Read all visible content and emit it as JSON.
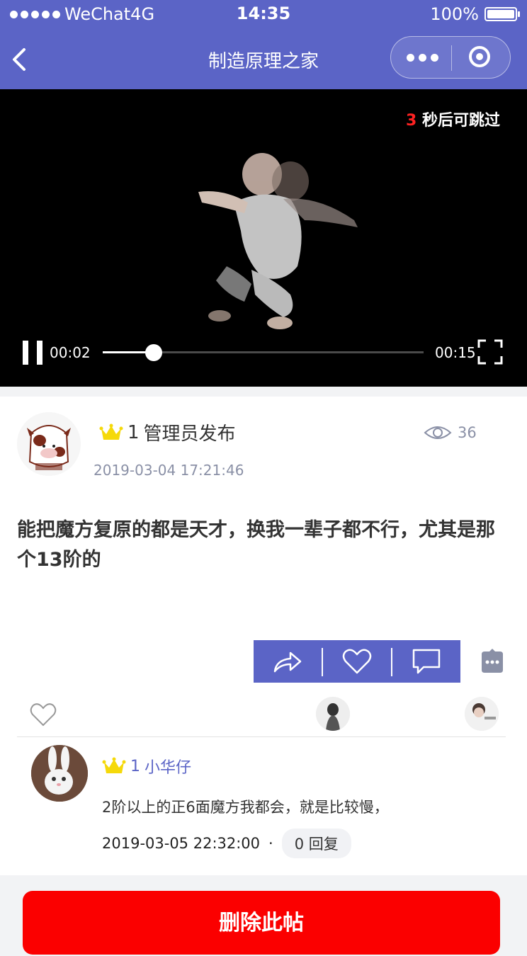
{
  "status_bar": {
    "carrier": "WeChat4G",
    "time": "14:35",
    "battery_label": "100%"
  },
  "nav": {
    "title": "制造原理之家",
    "back_icon": "chevron-left-icon",
    "more_icon": "more-dots-icon",
    "close_icon": "target-icon"
  },
  "video": {
    "skip_count": "3",
    "skip_text": "秒后可跳过",
    "current_time": "00:02",
    "total_time": "00:15",
    "progress": 0.16
  },
  "post": {
    "level": "1",
    "author_label": "管理员发布",
    "views": "36",
    "date": "2019-03-04 17:21:46",
    "content": "能把魔方复原的都是天才，换我一辈子都不行，尤其是那个13阶的"
  },
  "actions": {
    "share_icon": "share-icon",
    "like_icon": "heart-icon",
    "comment_icon": "comment-icon"
  },
  "comment": {
    "level": "1",
    "name": "小华仔",
    "text": "2阶以上的正6面魔方我都会，就是比较慢，",
    "date": "2019-03-05 22:32:00",
    "separator": "·",
    "reply_label": "0 回复"
  },
  "footer": {
    "delete_label": "删除此帖"
  },
  "colors": {
    "primary": "#5b64c6",
    "danger": "#fb0000",
    "crown": "#f5d90a"
  }
}
